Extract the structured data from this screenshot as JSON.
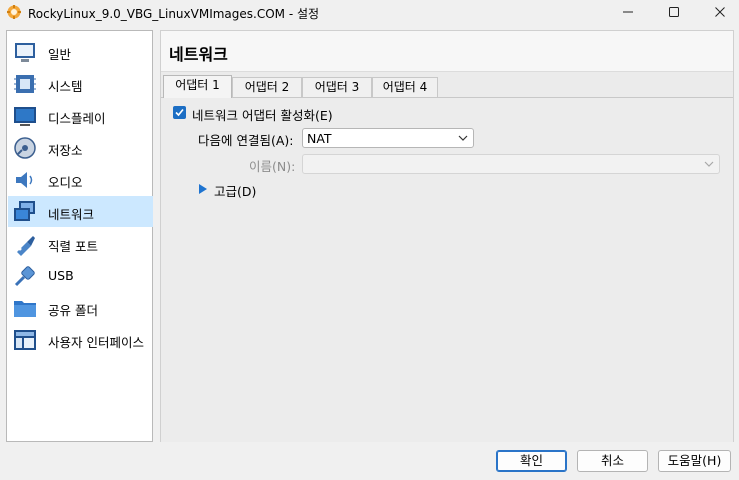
{
  "window": {
    "title": "RockyLinux_9.0_VBG_LinuxVMImages.COM - 설정",
    "minimize_icon": "minimize-icon",
    "maximize_icon": "maximize-icon",
    "close_icon": "close-icon"
  },
  "sidebar": {
    "items": [
      {
        "label": "일반",
        "icon": "general-icon"
      },
      {
        "label": "시스템",
        "icon": "system-icon"
      },
      {
        "label": "디스플레이",
        "icon": "display-icon"
      },
      {
        "label": "저장소",
        "icon": "storage-icon"
      },
      {
        "label": "오디오",
        "icon": "audio-icon"
      },
      {
        "label": "네트워크",
        "icon": "network-icon",
        "selected": true
      },
      {
        "label": "직렬 포트",
        "icon": "serial-port-icon"
      },
      {
        "label": "USB",
        "icon": "usb-icon"
      },
      {
        "label": "공유 폴더",
        "icon": "shared-folder-icon"
      },
      {
        "label": "사용자 인터페이스",
        "icon": "user-interface-icon"
      }
    ]
  },
  "main": {
    "title": "네트워크",
    "tabs": [
      {
        "label": "어댑터 1",
        "active": true
      },
      {
        "label": "어댑터 2"
      },
      {
        "label": "어댑터 3"
      },
      {
        "label": "어댑터 4"
      }
    ],
    "enable_adapter": {
      "label": "네트워크 어댑터 활성화(E)",
      "checked": true
    },
    "attached_to": {
      "label": "다음에 연결됨(A):",
      "value": "NAT"
    },
    "name": {
      "label": "이름(N):",
      "value": ""
    },
    "advanced": {
      "label": "고급(D)"
    }
  },
  "buttons": {
    "ok": "확인",
    "cancel": "취소",
    "help": "도움말(H)"
  },
  "colors": {
    "accent": "#1c6ec4",
    "selection": "#cce8ff"
  }
}
